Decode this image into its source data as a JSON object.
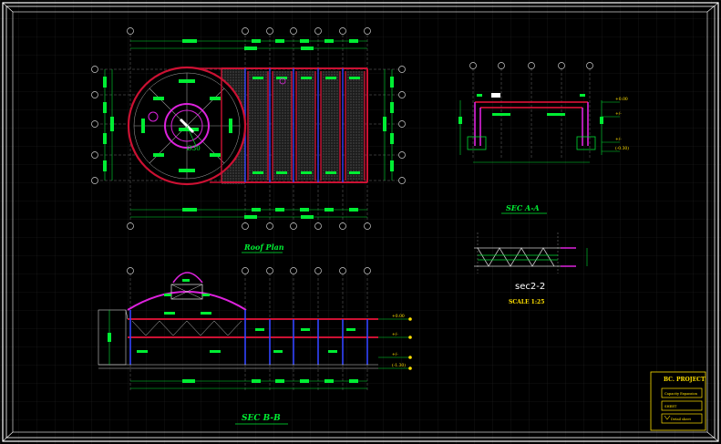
{
  "drawing": {
    "roof_plan_label": "Roof Plan",
    "sec_a_label": "SEC A-A",
    "sec_b_label": "SEC B-B",
    "sec2_label": "sec2-2",
    "scale_label": "SCALE 1:25",
    "title_block": {
      "project": "BC. PROJECT",
      "line1": "Capacity Expansion",
      "line2": "SHEET",
      "line3": "Detail sheet"
    }
  },
  "colors": {
    "background": "#000000",
    "frame": "#ffffff",
    "grid": "#2a2a2a",
    "structure": "#cc1133",
    "dims": "#00dd33",
    "magenta": "#dd22dd",
    "blue": "#3344ff",
    "tag": "#ffe000"
  }
}
